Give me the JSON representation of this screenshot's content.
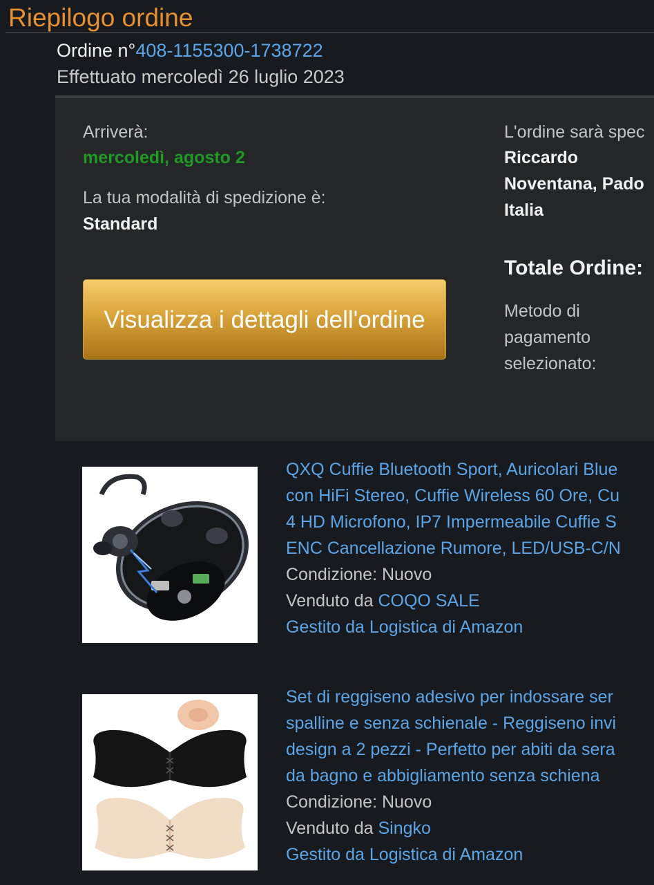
{
  "page": {
    "title": "Riepilogo ordine",
    "order_prefix": "Ordine n°",
    "order_number": "408-1155300-1738722",
    "placed": "Effettuato mercoledì 26 luglio 2023"
  },
  "delivery": {
    "arrives_label": "Arriverà:",
    "arrives_date": "mercoledì, agosto 2",
    "shipping_label": "La tua modalità di spedizione è:",
    "shipping_value": "Standard",
    "details_button": "Visualizza i dettagli dell'ordine"
  },
  "shipping_address": {
    "label": "L'ordine sarà spec",
    "name": "Riccardo",
    "city": "Noventana, Pado",
    "country": "Italia"
  },
  "totals": {
    "total_label": "Totale Ordine:",
    "payment_label_1": "Metodo di",
    "payment_label_2": "pagamento",
    "payment_label_3": "selezionato:"
  },
  "items": [
    {
      "title_lines": [
        "QXQ Cuffie Bluetooth Sport, Auricolari Blue",
        "con HiFi Stereo, Cuffie Wireless 60 Ore, Cu",
        "4 HD Microfono, IP7 Impermeabile Cuffie S",
        "ENC Cancellazione Rumore, LED/USB-C/N"
      ],
      "condition": "Condizione: Nuovo",
      "sold_by_label": "Venduto da ",
      "seller": "COQO SALE",
      "fulfilled": "Gestito da Logistica di Amazon",
      "image_icon": "earbuds-product-image"
    },
    {
      "title_lines": [
        "Set di reggiseno adesivo per indossare ser",
        "spalline e senza schienale - Reggiseno invi",
        "design a 2 pezzi - Perfetto per abiti da sera",
        "da bagno e abbigliamento senza schiena"
      ],
      "condition": "Condizione: Nuovo",
      "sold_by_label": "Venduto da ",
      "seller": "Singko",
      "fulfilled": "Gestito da Logistica di Amazon",
      "image_icon": "adhesive-bra-product-image"
    }
  ],
  "colors": {
    "accent_orange": "#e8902e",
    "link_blue": "#5ba4e6",
    "delivery_green": "#1f9a24",
    "button_gold": "#d9a33a"
  }
}
